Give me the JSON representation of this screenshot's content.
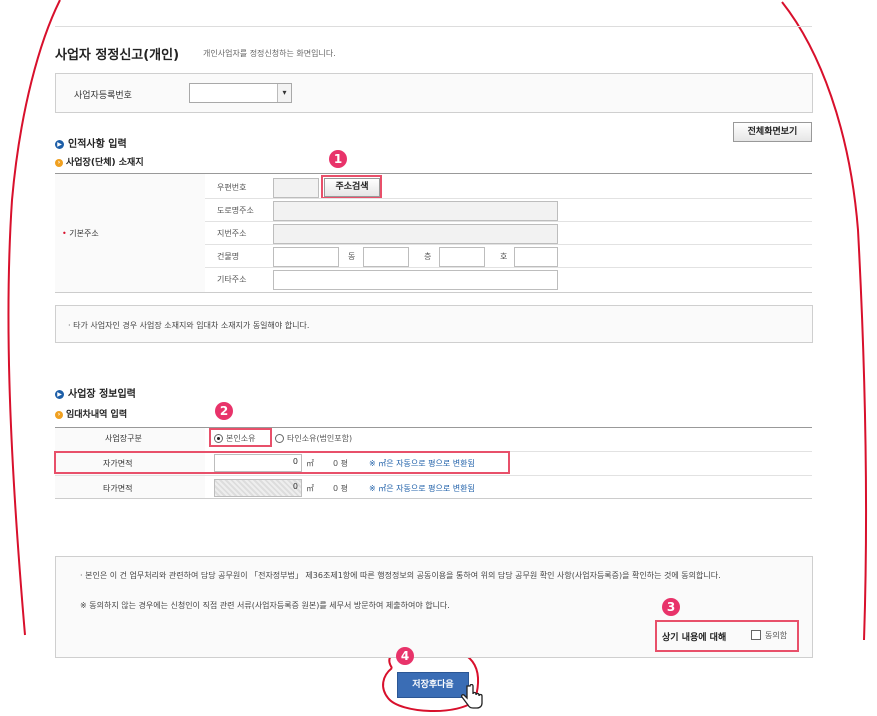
{
  "page": {
    "title": "사업자 정정신고(개인)",
    "description": "개인사업자를 정정신청하는 화면입니다."
  },
  "registration": {
    "label": "사업자등록번호",
    "value": ""
  },
  "buttons": {
    "full_screen": "전체화면보기",
    "address_search": "주소검색",
    "save_next": "저장후다음"
  },
  "section1": {
    "title": "인적사항 입력",
    "subtitle": "사업장(단체) 소재지",
    "basic_address_label": "기본주소",
    "fields": {
      "postal": "우편번호",
      "road": "도로명주소",
      "jibun": "지번주소",
      "building": "건물명",
      "dong": "동",
      "floor": "층",
      "ho": "호",
      "other": "기타주소"
    },
    "notice": "타가 사업자인 경우 사업장 소재지와 임대차 소재지가 동일해야 합니다."
  },
  "section2": {
    "title": "사업장 정보입력",
    "subtitle": "임대차내역 입력",
    "rows": {
      "type_label": "사업장구분",
      "own_area_label": "자가면적",
      "other_area_label": "타가면적"
    },
    "radio": {
      "self": "본인소유",
      "other": "타인소유(법인포함)"
    },
    "own_area": {
      "value": "0",
      "unit": "㎡",
      "pyeong": "0 평"
    },
    "other_area": {
      "value": "0",
      "unit": "㎡",
      "pyeong": "0 평"
    },
    "conversion_note": "※ ㎡은 자동으로 평으로 변환됨"
  },
  "consent": {
    "text1": "본인은 이 건 업무처리와 관련하여 담당 공무원이 「전자정부법」 제36조제1항에 따른 행정정보의 공동이용을 통하여 위의 담당 공무원 확인 사항(사업자등록증)을 확인하는 것에 동의합니다.",
    "text2": "※ 동의하지 않는 경우에는 신청인이 직접 관련 서류(사업자등록증 원본)를 세무서 방문하여 제출하여야 합니다.",
    "label": "상기 내용에 대해",
    "agree": "동의함"
  },
  "badges": [
    "1",
    "2",
    "3",
    "4"
  ],
  "colors": {
    "highlight": "#e8506a",
    "badge": "#e8336a",
    "primary": "#3a6db5",
    "bullet_blue": "#1e5fa8",
    "bullet_orange": "#f0a020"
  }
}
